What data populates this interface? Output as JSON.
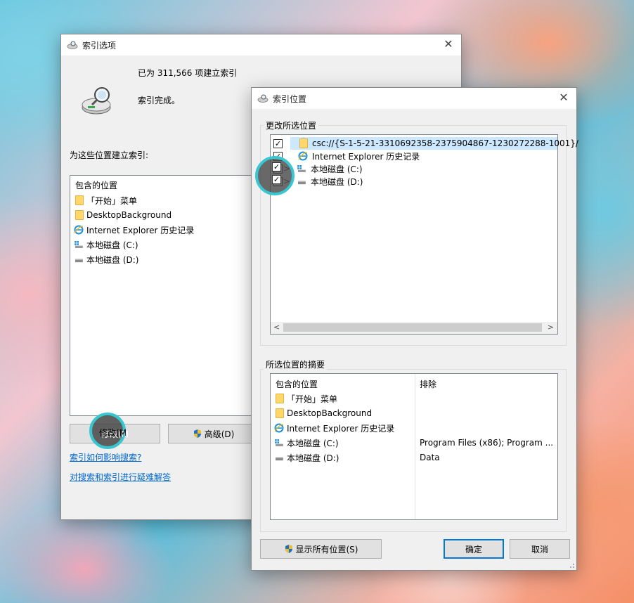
{
  "back_window": {
    "title": "索引选项",
    "status_count": "已为 311,566 项建立索引",
    "status_state": "索引完成。",
    "section_label": "为这些位置建立索引:",
    "list_header": "包含的位置",
    "items": [
      {
        "icon": "folder-icon",
        "label": "「开始」菜单"
      },
      {
        "icon": "folder-icon",
        "label": "DesktopBackground"
      },
      {
        "icon": "ie-icon",
        "label": "Internet Explorer 历史记录"
      },
      {
        "icon": "windows-drive-icon",
        "label": "本地磁盘 (C:)"
      },
      {
        "icon": "drive-icon",
        "label": "本地磁盘 (D:)"
      }
    ],
    "modify_button": "修改(M",
    "advanced_button": "高级(D)",
    "link_how": "索引如何影响搜索?",
    "link_troubleshoot": "对搜索和索引进行疑难解答"
  },
  "front_window": {
    "title": "索引位置",
    "change_group_label": "更改所选位置",
    "tree_items": [
      {
        "checked": true,
        "icon": "folder-icon",
        "label": "csc://{S-1-5-21-3310692358-2375904867-1230272288-1001}/",
        "selected": true
      },
      {
        "checked": true,
        "icon": "ie-icon",
        "label": "Internet Explorer 历史记录"
      },
      {
        "checked": true,
        "icon": "windows-drive-icon",
        "label": "本地磁盘 (C:)",
        "expand": ">"
      },
      {
        "checked": true,
        "icon": "drive-icon",
        "label": "本地磁盘 (D:)",
        "expand": ">"
      }
    ],
    "summary_group_label": "所选位置的摘要",
    "summary_col_included": "包含的位置",
    "summary_col_excluded": "排除",
    "summary_rows": [
      {
        "icon": "folder-icon",
        "label": "「开始」菜单",
        "excluded": ""
      },
      {
        "icon": "folder-icon",
        "label": "DesktopBackground",
        "excluded": ""
      },
      {
        "icon": "ie-icon",
        "label": "Internet Explorer 历史记录",
        "excluded": ""
      },
      {
        "icon": "windows-drive-icon",
        "label": "本地磁盘 (C:)",
        "excluded": "Program Files (x86); Program ..."
      },
      {
        "icon": "drive-icon",
        "label": "本地磁盘 (D:)",
        "excluded": "Data"
      }
    ],
    "show_all_button": "显示所有位置(S)",
    "ok_button": "确定",
    "cancel_button": "取消",
    "scroll_left": "<",
    "scroll_right": ">"
  },
  "close_glyph": "✕",
  "colors": {
    "accent": "#0078d7",
    "highlight_ring": "#38c6d0",
    "link": "#0066cc"
  }
}
